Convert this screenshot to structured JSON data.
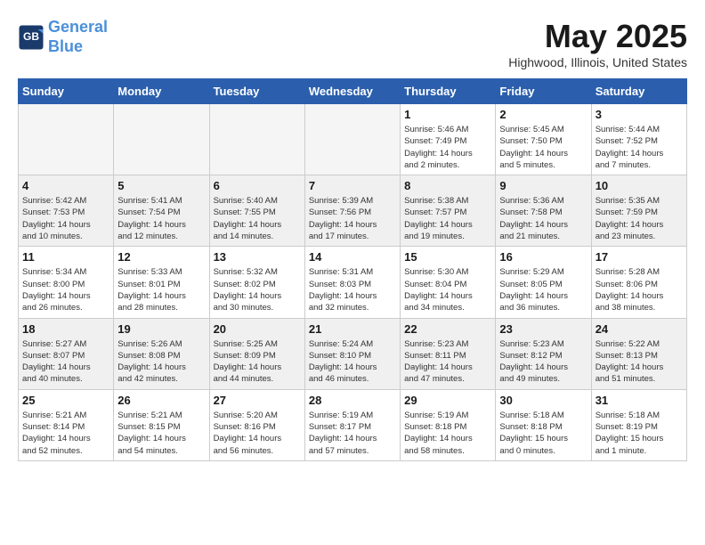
{
  "logo": {
    "line1": "General",
    "line2": "Blue"
  },
  "title": "May 2025",
  "location": "Highwood, Illinois, United States",
  "days_of_week": [
    "Sunday",
    "Monday",
    "Tuesday",
    "Wednesday",
    "Thursday",
    "Friday",
    "Saturday"
  ],
  "weeks": [
    [
      {
        "day": "",
        "info": ""
      },
      {
        "day": "",
        "info": ""
      },
      {
        "day": "",
        "info": ""
      },
      {
        "day": "",
        "info": ""
      },
      {
        "day": "1",
        "info": "Sunrise: 5:46 AM\nSunset: 7:49 PM\nDaylight: 14 hours\nand 2 minutes."
      },
      {
        "day": "2",
        "info": "Sunrise: 5:45 AM\nSunset: 7:50 PM\nDaylight: 14 hours\nand 5 minutes."
      },
      {
        "day": "3",
        "info": "Sunrise: 5:44 AM\nSunset: 7:52 PM\nDaylight: 14 hours\nand 7 minutes."
      }
    ],
    [
      {
        "day": "4",
        "info": "Sunrise: 5:42 AM\nSunset: 7:53 PM\nDaylight: 14 hours\nand 10 minutes."
      },
      {
        "day": "5",
        "info": "Sunrise: 5:41 AM\nSunset: 7:54 PM\nDaylight: 14 hours\nand 12 minutes."
      },
      {
        "day": "6",
        "info": "Sunrise: 5:40 AM\nSunset: 7:55 PM\nDaylight: 14 hours\nand 14 minutes."
      },
      {
        "day": "7",
        "info": "Sunrise: 5:39 AM\nSunset: 7:56 PM\nDaylight: 14 hours\nand 17 minutes."
      },
      {
        "day": "8",
        "info": "Sunrise: 5:38 AM\nSunset: 7:57 PM\nDaylight: 14 hours\nand 19 minutes."
      },
      {
        "day": "9",
        "info": "Sunrise: 5:36 AM\nSunset: 7:58 PM\nDaylight: 14 hours\nand 21 minutes."
      },
      {
        "day": "10",
        "info": "Sunrise: 5:35 AM\nSunset: 7:59 PM\nDaylight: 14 hours\nand 23 minutes."
      }
    ],
    [
      {
        "day": "11",
        "info": "Sunrise: 5:34 AM\nSunset: 8:00 PM\nDaylight: 14 hours\nand 26 minutes."
      },
      {
        "day": "12",
        "info": "Sunrise: 5:33 AM\nSunset: 8:01 PM\nDaylight: 14 hours\nand 28 minutes."
      },
      {
        "day": "13",
        "info": "Sunrise: 5:32 AM\nSunset: 8:02 PM\nDaylight: 14 hours\nand 30 minutes."
      },
      {
        "day": "14",
        "info": "Sunrise: 5:31 AM\nSunset: 8:03 PM\nDaylight: 14 hours\nand 32 minutes."
      },
      {
        "day": "15",
        "info": "Sunrise: 5:30 AM\nSunset: 8:04 PM\nDaylight: 14 hours\nand 34 minutes."
      },
      {
        "day": "16",
        "info": "Sunrise: 5:29 AM\nSunset: 8:05 PM\nDaylight: 14 hours\nand 36 minutes."
      },
      {
        "day": "17",
        "info": "Sunrise: 5:28 AM\nSunset: 8:06 PM\nDaylight: 14 hours\nand 38 minutes."
      }
    ],
    [
      {
        "day": "18",
        "info": "Sunrise: 5:27 AM\nSunset: 8:07 PM\nDaylight: 14 hours\nand 40 minutes."
      },
      {
        "day": "19",
        "info": "Sunrise: 5:26 AM\nSunset: 8:08 PM\nDaylight: 14 hours\nand 42 minutes."
      },
      {
        "day": "20",
        "info": "Sunrise: 5:25 AM\nSunset: 8:09 PM\nDaylight: 14 hours\nand 44 minutes."
      },
      {
        "day": "21",
        "info": "Sunrise: 5:24 AM\nSunset: 8:10 PM\nDaylight: 14 hours\nand 46 minutes."
      },
      {
        "day": "22",
        "info": "Sunrise: 5:23 AM\nSunset: 8:11 PM\nDaylight: 14 hours\nand 47 minutes."
      },
      {
        "day": "23",
        "info": "Sunrise: 5:23 AM\nSunset: 8:12 PM\nDaylight: 14 hours\nand 49 minutes."
      },
      {
        "day": "24",
        "info": "Sunrise: 5:22 AM\nSunset: 8:13 PM\nDaylight: 14 hours\nand 51 minutes."
      }
    ],
    [
      {
        "day": "25",
        "info": "Sunrise: 5:21 AM\nSunset: 8:14 PM\nDaylight: 14 hours\nand 52 minutes."
      },
      {
        "day": "26",
        "info": "Sunrise: 5:21 AM\nSunset: 8:15 PM\nDaylight: 14 hours\nand 54 minutes."
      },
      {
        "day": "27",
        "info": "Sunrise: 5:20 AM\nSunset: 8:16 PM\nDaylight: 14 hours\nand 56 minutes."
      },
      {
        "day": "28",
        "info": "Sunrise: 5:19 AM\nSunset: 8:17 PM\nDaylight: 14 hours\nand 57 minutes."
      },
      {
        "day": "29",
        "info": "Sunrise: 5:19 AM\nSunset: 8:18 PM\nDaylight: 14 hours\nand 58 minutes."
      },
      {
        "day": "30",
        "info": "Sunrise: 5:18 AM\nSunset: 8:18 PM\nDaylight: 15 hours\nand 0 minutes."
      },
      {
        "day": "31",
        "info": "Sunrise: 5:18 AM\nSunset: 8:19 PM\nDaylight: 15 hours\nand 1 minute."
      }
    ]
  ]
}
